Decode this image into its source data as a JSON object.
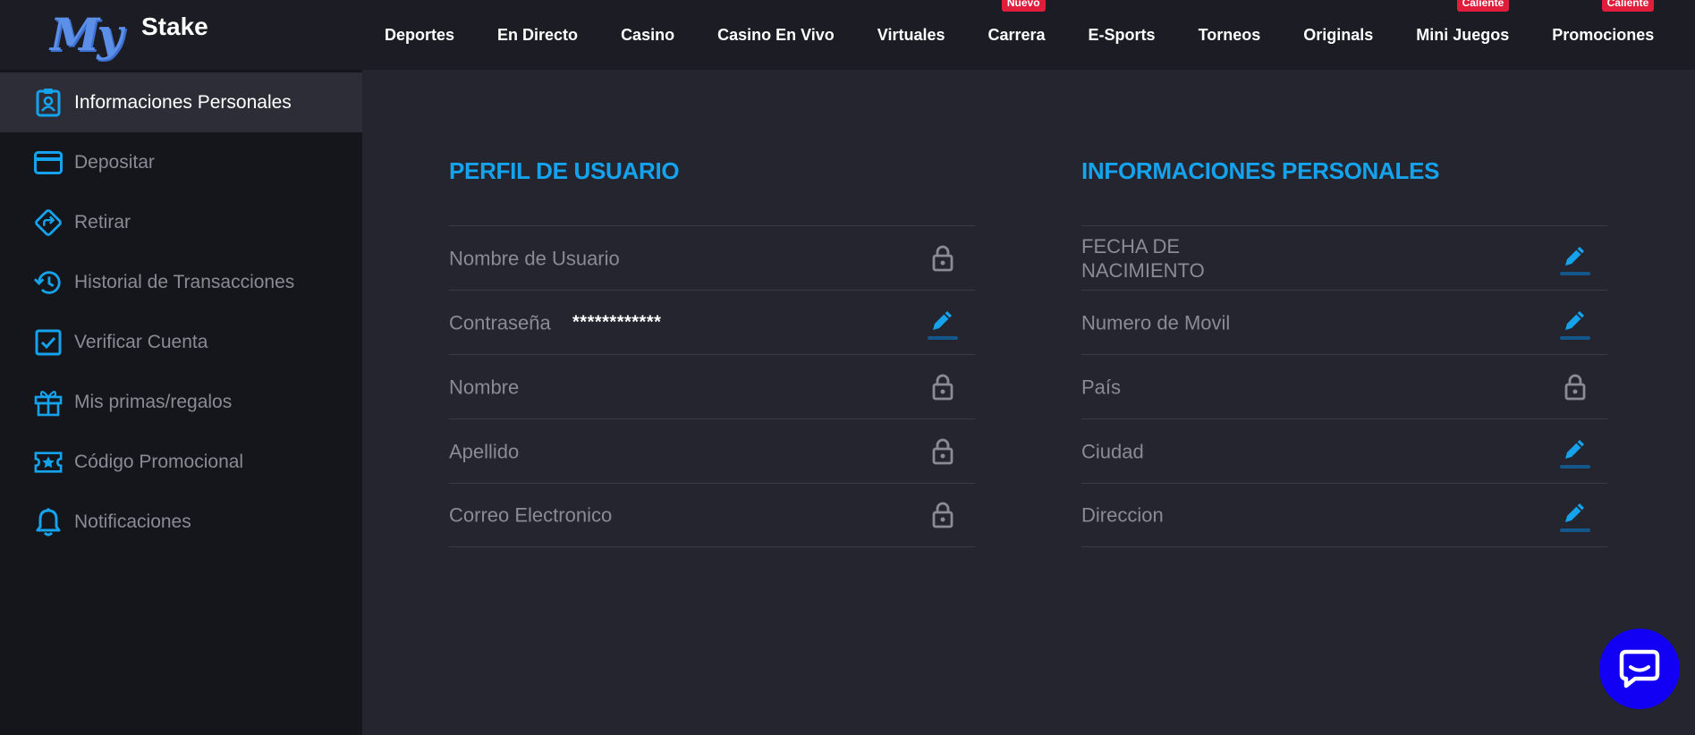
{
  "brand": {
    "logo_my": "My",
    "logo_stake": "Stake"
  },
  "nav": {
    "items": [
      {
        "label": "Deportes",
        "badge": ""
      },
      {
        "label": "En Directo",
        "badge": ""
      },
      {
        "label": "Casino",
        "badge": ""
      },
      {
        "label": "Casino En Vivo",
        "badge": ""
      },
      {
        "label": "Virtuales",
        "badge": ""
      },
      {
        "label": "Carrera",
        "badge": "Nuevo"
      },
      {
        "label": "E-Sports",
        "badge": ""
      },
      {
        "label": "Torneos",
        "badge": ""
      },
      {
        "label": "Originals",
        "badge": ""
      },
      {
        "label": "Mini Juegos",
        "badge": "Caliente"
      },
      {
        "label": "Promociones",
        "badge": "Caliente"
      }
    ]
  },
  "sidebar": {
    "items": [
      {
        "label": "Informaciones Personales",
        "icon": "id-badge-icon",
        "active": true
      },
      {
        "label": "Depositar",
        "icon": "credit-card-icon",
        "active": false
      },
      {
        "label": "Retirar",
        "icon": "direction-sign-icon",
        "active": false
      },
      {
        "label": "Historial de Transacciones",
        "icon": "history-icon",
        "active": false
      },
      {
        "label": "Verificar Cuenta",
        "icon": "checkbox-icon",
        "active": false
      },
      {
        "label": "Mis primas/regalos",
        "icon": "gift-icon",
        "active": false
      },
      {
        "label": "Código Promocional",
        "icon": "ticket-star-icon",
        "active": false
      },
      {
        "label": "Notificaciones",
        "icon": "bell-icon",
        "active": false
      }
    ]
  },
  "profile": {
    "title": "PERFIL DE USUARIO",
    "fields": [
      {
        "label": "Nombre de Usuario",
        "value": "",
        "action": "lock-icon"
      },
      {
        "label": "Contraseña",
        "value": "************",
        "action": "pencil-icon"
      },
      {
        "label": "Nombre",
        "value": "",
        "action": "lock-icon"
      },
      {
        "label": "Apellido",
        "value": "",
        "action": "lock-icon"
      },
      {
        "label": "Correo Electronico",
        "value": "",
        "action": "lock-icon"
      }
    ]
  },
  "personal": {
    "title": "INFORMACIONES PERSONALES",
    "fields": [
      {
        "label": "FECHA DE\nNACIMIENTO",
        "action": "pencil-icon"
      },
      {
        "label": "Numero de Movil",
        "action": "pencil-icon"
      },
      {
        "label": "País",
        "action": "lock-icon"
      },
      {
        "label": "Ciudad",
        "action": "pencil-icon"
      },
      {
        "label": "Direccion",
        "action": "pencil-icon"
      }
    ]
  },
  "colors": {
    "accent": "#14a3ec",
    "badge": "#e01e3c",
    "chat": "#1200f5",
    "muted": "#8a8b94"
  },
  "chat": {
    "icon": "chat-bubble-icon"
  }
}
